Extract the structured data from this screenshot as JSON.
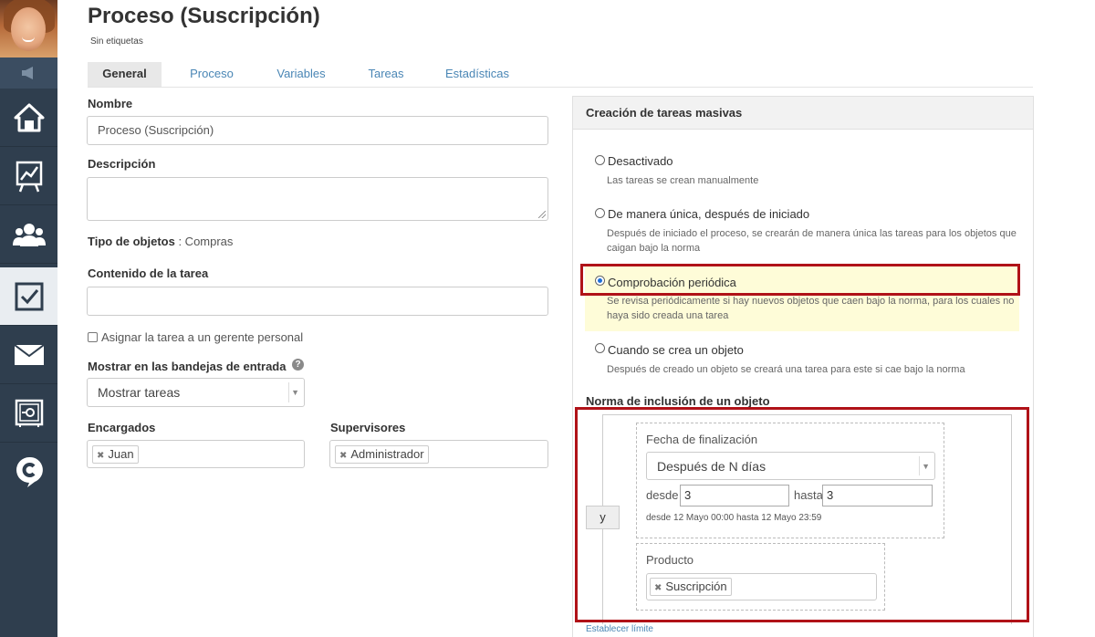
{
  "page": {
    "title": "Proceso (Suscripción)",
    "tags": "Sin etiquetas"
  },
  "tabs": [
    {
      "label": "General",
      "active": true
    },
    {
      "label": "Proceso",
      "active": false
    },
    {
      "label": "Variables",
      "active": false
    },
    {
      "label": "Tareas",
      "active": false
    },
    {
      "label": "Estadísticas",
      "active": false
    }
  ],
  "sidebar": {
    "items": [
      {
        "icon": "home-icon"
      },
      {
        "icon": "chart-board-icon"
      },
      {
        "icon": "users-icon"
      },
      {
        "icon": "tasks-check-icon",
        "active": true
      },
      {
        "icon": "mail-icon"
      },
      {
        "icon": "safe-icon"
      },
      {
        "icon": "chat-c-icon"
      }
    ]
  },
  "form": {
    "name_label": "Nombre",
    "name_value": "Proceso (Suscripción)",
    "description_label": "Descripción",
    "description_value": "",
    "object_type_label": "Tipo de objetos",
    "object_type_value": ": Compras",
    "task_content_label": "Contenido de la tarea",
    "task_content_value": "",
    "assign_manager_label": "Asignar la tarea a un gerente personal",
    "assign_manager_checked": false,
    "inbox_label": "Mostrar en las bandejas de entrada",
    "inbox_value": "Mostrar tareas",
    "assignees_label": "Encargados",
    "assignees": [
      "Juan"
    ],
    "supervisors_label": "Supervisores",
    "supervisors": [
      "Administrador"
    ]
  },
  "mass": {
    "header": "Creación de tareas masivas",
    "options": [
      {
        "label": "Desactivado",
        "desc": "Las tareas se crean manualmente",
        "checked": false
      },
      {
        "label": "De manera única, después de iniciado",
        "desc": "Después de iniciado el proceso, se crearán de manera única las tareas para los objetos que",
        "desc2": "caigan bajo la norma",
        "checked": false
      },
      {
        "label": "Comprobación periódica",
        "desc": "Se revisa periódicamente si hay nuevos objetos que caen bajo la norma, para los cuales no",
        "desc2": "haya sido creada una tarea",
        "checked": true
      },
      {
        "label": "Cuando se crea un objeto",
        "desc": "Después de creado un objeto se creará una tarea para este si cae bajo la norma",
        "checked": false
      }
    ]
  },
  "rule": {
    "title": "Norma de inclusión de un objeto",
    "operator": "y",
    "date_field": "Fecha de finalización",
    "date_mode": "Después de N días",
    "from_label": "desde",
    "from_value": "3",
    "to_label": "hasta",
    "to_value": "3",
    "range_text": "desde 12 Mayo 00:00 hasta 12 Mayo 23:59",
    "product_label": "Producto",
    "products": [
      "Suscripción"
    ],
    "limit_link": "Establecer límite"
  }
}
